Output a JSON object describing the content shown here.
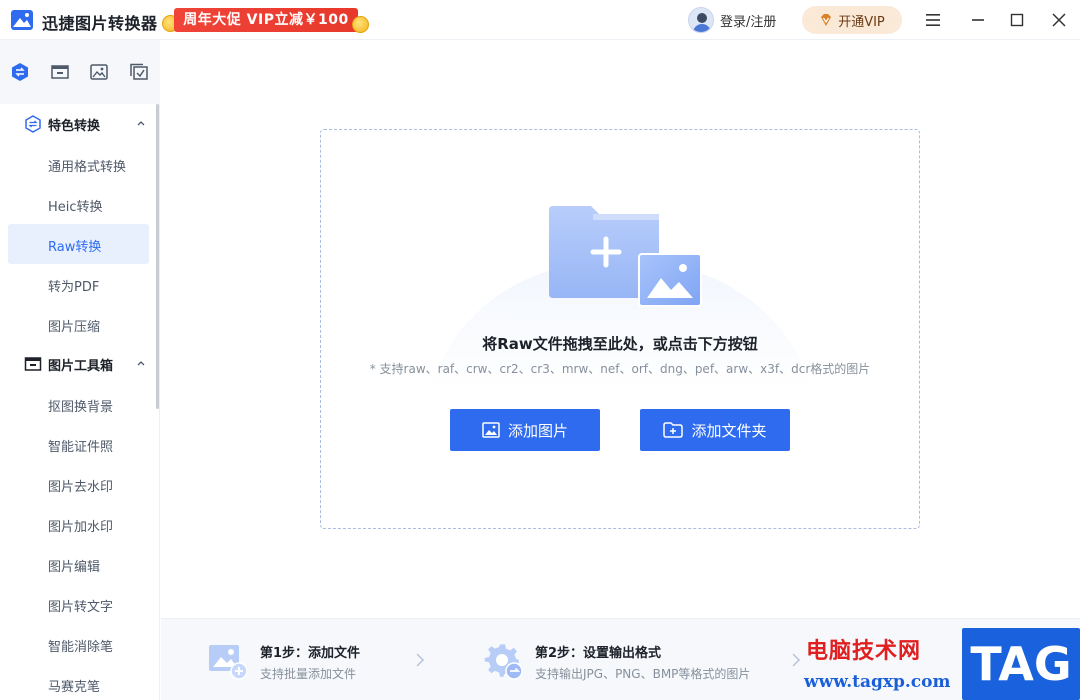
{
  "app": {
    "title": "迅捷图片转换器",
    "promo": "周年大促 VIP立减￥100",
    "login": "登录/注册",
    "vip": "开通VIP"
  },
  "sidebar": {
    "sections": [
      {
        "label": "特色转换",
        "items": [
          "通用格式转换",
          "Heic转换",
          "Raw转换",
          "转为PDF",
          "图片压缩"
        ],
        "active_index": 2
      },
      {
        "label": "图片工具箱",
        "items": [
          "抠图换背景",
          "智能证件照",
          "图片去水印",
          "图片加水印",
          "图片编辑",
          "图片转文字",
          "智能消除笔",
          "马赛克笔"
        ]
      }
    ]
  },
  "dropzone": {
    "title": "将Raw文件拖拽至此处，或点击下方按钮",
    "hint": "* 支持raw、raf、crw、cr2、cr3、mrw、nef、orf、dng、pef、arw、x3f、dcr格式的图片",
    "add_image": "添加图片",
    "add_folder": "添加文件夹"
  },
  "steps": [
    {
      "title": "第1步：添加文件",
      "desc": "支持批量添加文件"
    },
    {
      "title": "第2步：设置输出格式",
      "desc": "支持输出JPG、PNG、BMP等格式的图片"
    }
  ],
  "watermark": {
    "text": "电脑技术网",
    "url": "www.tagxp.com",
    "tag": "TAG"
  },
  "colors": {
    "primary": "#2f6bef",
    "active_bg": "#e8f0fe",
    "promo": "#f04438"
  }
}
